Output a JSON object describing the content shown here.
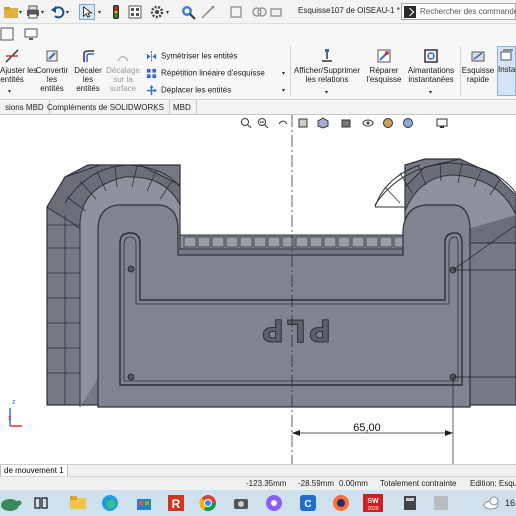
{
  "title_bar": {
    "document_title": "Esquisse107 de OISEAU-1 *",
    "search_placeholder": "Rechercher des commandes"
  },
  "ribbon": {
    "ajuster_label": "Ajuster les\nentités",
    "convertir_label": "Convertir\nles\nentités",
    "decaler_label": "Décaler\nles\nentités",
    "decalage_surface_label": "Décalage\nsur la\nsurface",
    "symetriser_label": "Symétriser les entités",
    "repetition_label": "Répétition linéaire d'esquisse",
    "deplacer_label": "Déplacer les entités",
    "afficher_relations_label": "Afficher/Supprimer\nles relations",
    "reparer_label": "Réparer\nl'esquisse",
    "aimantations_label": "Aimantations\ninstantanées",
    "esquisse_rapide_label": "Esquisse\nrapide",
    "instant_label": "Insta"
  },
  "tabs": [
    {
      "label": "sions MBD"
    },
    {
      "label": "Compléments de SOLIDWORKS"
    },
    {
      "label": "MBD"
    }
  ],
  "canvas": {
    "dimension_value": "65,00",
    "engraved_text": "PLP",
    "triad_x": "x",
    "triad_z": "z"
  },
  "status": {
    "motion_tab": "de mouvement 1",
    "x_coord": "-123.35mm",
    "y_coord": "-28.59mm",
    "z_coord": "0.00mm",
    "constraint": "Totalement contrainte",
    "edition": "Edition: Esqu"
  },
  "taskbar": {
    "time": "16"
  },
  "colors": {
    "part_fill": "#7a7d87",
    "part_dark": "#4e5159",
    "part_light": "#9a9ca6",
    "highlight": "#dbe9f7",
    "accent": "#0078d7"
  }
}
